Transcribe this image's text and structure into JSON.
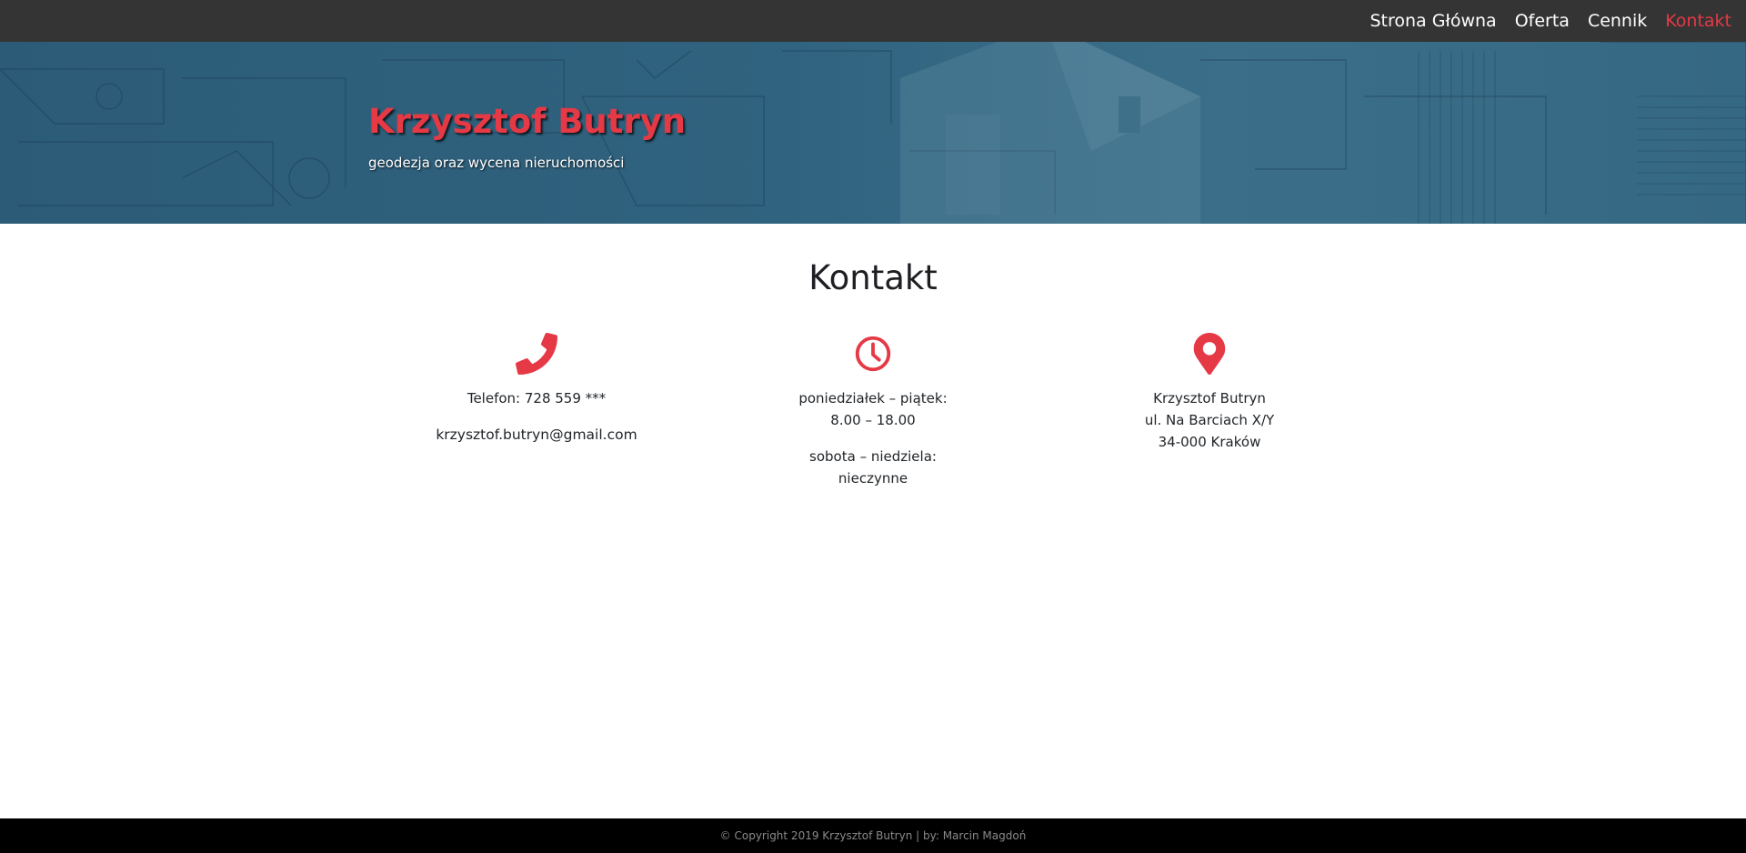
{
  "nav": {
    "items": [
      {
        "label": "Strona Główna"
      },
      {
        "label": "Oferta"
      },
      {
        "label": "Cennik"
      },
      {
        "label": "Kontakt",
        "active": true
      }
    ]
  },
  "hero": {
    "title": "Krzysztof Butryn",
    "subtitle": "geodezja oraz wycena nieruchomości"
  },
  "contact": {
    "title": "Kontakt",
    "phone": {
      "icon": "phone-icon",
      "text": "Telefon: 728 559 ***",
      "email": "krzysztof.butryn@gmail.com"
    },
    "hours": {
      "icon": "clock-icon",
      "weekdays_label": "poniedziałek – piątek:",
      "weekdays_value": "8.00 – 18.00",
      "weekend_label": "sobota – niedziela:",
      "weekend_value": "nieczynne"
    },
    "address": {
      "icon": "map-pin-icon",
      "name": "Krzysztof Butryn",
      "street": "ul. Na Barciach X/Y",
      "city": "34-000 Kraków"
    }
  },
  "footer": {
    "text": "© Copyright 2019 Krzysztof Butryn | by: Marcin Magdoń"
  },
  "colors": {
    "accent": "#e63946",
    "navbar": "#343434",
    "hero": "#2f617d",
    "footer": "#000000"
  }
}
